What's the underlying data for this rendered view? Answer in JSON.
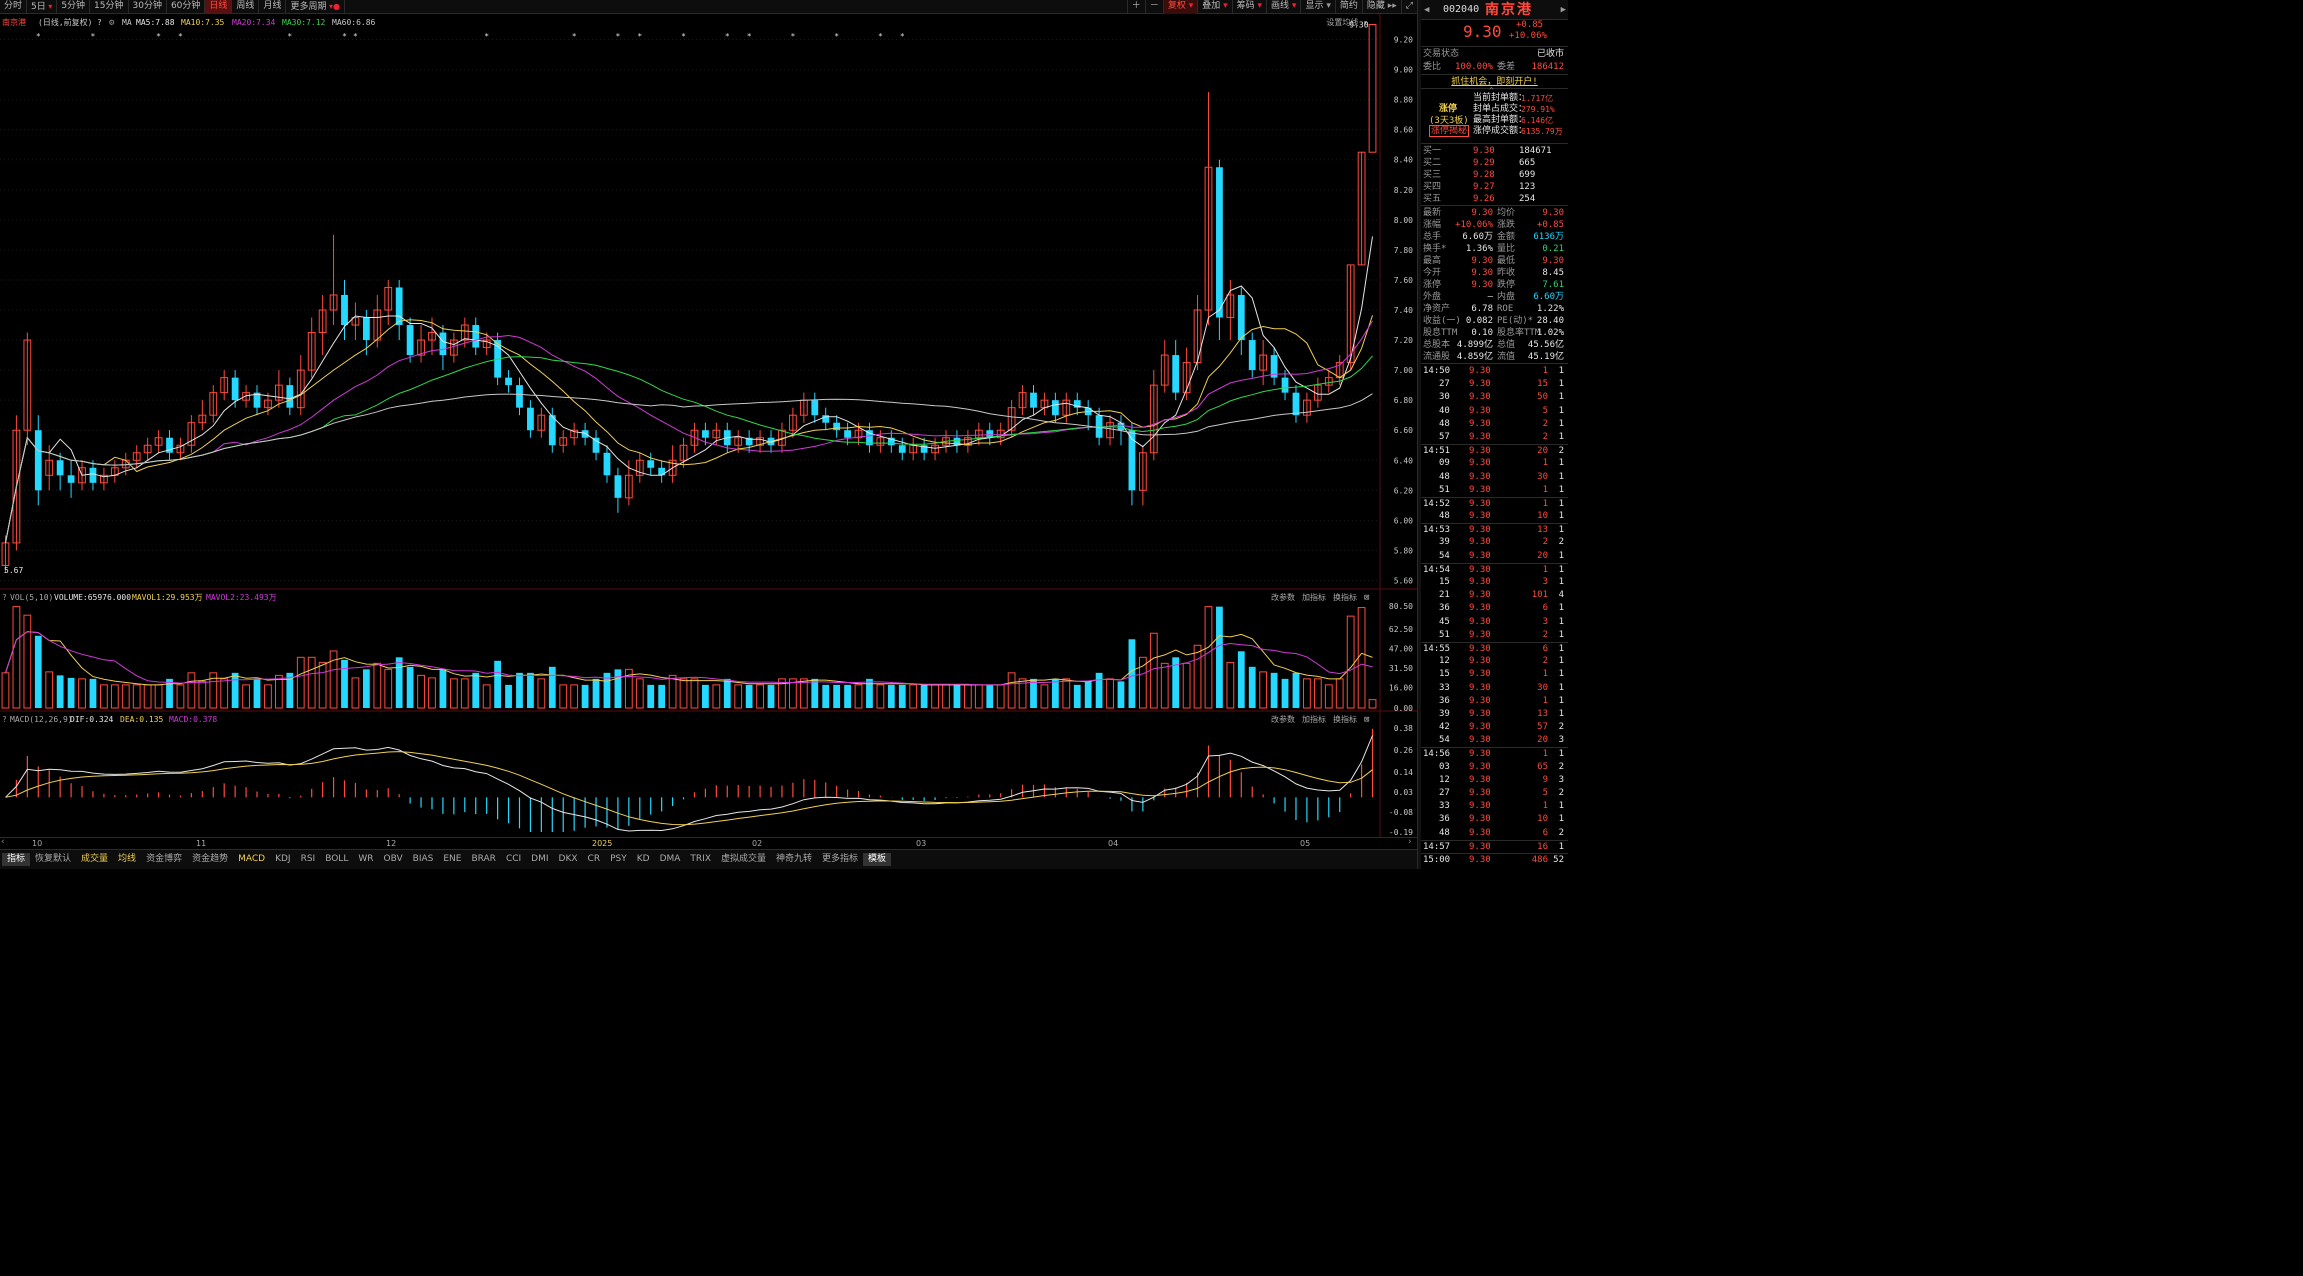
{
  "topbar": {
    "period_tabs": [
      "分时",
      "5日",
      "5分钟",
      "15分钟",
      "30分钟",
      "60分钟",
      "日线",
      "周线",
      "月线",
      "更多周期"
    ],
    "active_period": "日线",
    "tools": [
      "复权",
      "叠加",
      "筹码",
      "画线",
      "显示",
      "简约",
      "隐藏"
    ]
  },
  "main_legend": {
    "name": "南京港",
    "mode": "(日线,前复权)",
    "q": "?",
    "ma_label": "MA",
    "ma5": "MA5:7.88",
    "ma10": "MA10:7.35",
    "ma20": "MA20:7.34",
    "ma30": "MA30:7.12",
    "ma60": "MA60:6.86",
    "settings": "设置均线"
  },
  "main_axis": [
    "9.20",
    "9.00",
    "8.80",
    "8.60",
    "8.40",
    "8.20",
    "8.00",
    "7.80",
    "7.60",
    "7.40",
    "7.20",
    "7.00",
    "6.80",
    "6.60",
    "6.40",
    "6.20",
    "6.00",
    "5.80",
    "5.60"
  ],
  "main_labels": {
    "last_price": "9.30",
    "low_price": "5.67"
  },
  "vol_legend": {
    "params": "VOL(5,10)",
    "volume": "VOLUME:65976.000",
    "mavol1": "MAVOL1:29.953万",
    "mavol2": "MAVOL2:23.493万",
    "actions": [
      "改参数",
      "加指标",
      "换指标"
    ]
  },
  "vol_axis": [
    "80.50",
    "62.50",
    "47.00",
    "31.50",
    "16.00",
    "0.00"
  ],
  "macd_legend": {
    "params": "MACD(12,26,9)",
    "dif": "DIF:0.324",
    "dea": "DEA:0.135",
    "macd": "MACD:0.378",
    "actions": [
      "改参数",
      "加指标",
      "换指标"
    ]
  },
  "macd_axis": [
    "0.38",
    "0.26",
    "0.14",
    "0.03",
    "-0.08",
    "-0.19"
  ],
  "xaxis": [
    "10",
    "11",
    "12",
    "2025",
    "02",
    "03",
    "04",
    "05"
  ],
  "bottom_tabs": [
    "指标",
    "恢复默认",
    "成交量",
    "均线",
    "资金博弈",
    "资金趋势",
    "MACD",
    "KDJ",
    "RSI",
    "BOLL",
    "WR",
    "OBV",
    "BIAS",
    "ENE",
    "BRAR",
    "CCI",
    "DMI",
    "DKX",
    "CR",
    "PSY",
    "KD",
    "DMA",
    "TRIX",
    "虚拟成交量",
    "神奇九转",
    "更多指标",
    "模板"
  ],
  "bottom_selected": [
    "指标",
    "模板"
  ],
  "bottom_highlight": [
    "成交量",
    "均线",
    "MACD"
  ],
  "colors": {
    "up": "#ff4a3d",
    "down": "#25d8ff",
    "ma5": "#e6e6e6",
    "ma10": "#f0d050",
    "ma20": "#d03ad8",
    "ma30": "#2fd84a",
    "ma60": "#c8c8c8"
  },
  "quote": {
    "code": "002040",
    "name": "南京港",
    "price": "9.30",
    "change": "+0.85",
    "change_pct": "+10.06%",
    "status_label": "交易状态",
    "status_value": "已收市",
    "ratio_label": "委比",
    "ratio_value": "100.00%",
    "diff_label": "委差",
    "diff_value": "186412",
    "promo": "抓住机会，即刻开户!",
    "limit": {
      "tag": "涨停",
      "sub": "(3天3板)",
      "btn": "涨停揭秘",
      "rows": [
        {
          "label": "当前封单额：",
          "value": "1.717亿"
        },
        {
          "label": "封单占成交：",
          "value": "279.91%"
        },
        {
          "label": "最高封单额：",
          "value": "6.146亿"
        },
        {
          "label": "涨停成交额：",
          "value": "6135.79万"
        }
      ]
    },
    "buy": [
      {
        "label": "买一",
        "price": "9.30",
        "vol": "184671"
      },
      {
        "label": "买二",
        "price": "9.29",
        "vol": "665"
      },
      {
        "label": "买三",
        "price": "9.28",
        "vol": "699"
      },
      {
        "label": "买四",
        "price": "9.27",
        "vol": "123"
      },
      {
        "label": "买五",
        "price": "9.26",
        "vol": "254"
      }
    ],
    "stats": [
      [
        "最新",
        "9.30",
        "均价",
        "9.30"
      ],
      [
        "涨幅",
        "+10.06%",
        "涨跌",
        "+0.85"
      ],
      [
        "总手",
        "6.60万",
        "金额",
        "6136万"
      ],
      [
        "换手*",
        "1.36%",
        "量比",
        "0.21"
      ],
      [
        "最高",
        "9.30",
        "最低",
        "9.30"
      ],
      [
        "今开",
        "9.30",
        "昨收",
        "8.45"
      ],
      [
        "涨停",
        "9.30",
        "跌停",
        "7.61"
      ],
      [
        "外盘",
        "—",
        "内盘",
        "6.60万"
      ],
      [
        "净资产",
        "6.78",
        "ROE",
        "1.22%"
      ],
      [
        "收益(一)",
        "0.082",
        "PE(动)*",
        "28.40"
      ],
      [
        "股息TTM",
        "0.10",
        "股息率TTM",
        "1.02%"
      ],
      [
        "总股本",
        "4.899亿",
        "总值",
        "45.56亿"
      ],
      [
        "流通股",
        "4.859亿",
        "流值",
        "45.19亿"
      ]
    ]
  },
  "ticks": [
    {
      "time": "14:50",
      "price": "9.30",
      "vol": "1",
      "n": "1",
      "head": true
    },
    {
      "time": "27",
      "price": "9.30",
      "vol": "15",
      "n": "1"
    },
    {
      "time": "30",
      "price": "9.30",
      "vol": "50",
      "n": "1"
    },
    {
      "time": "40",
      "price": "9.30",
      "vol": "5",
      "n": "1"
    },
    {
      "time": "48",
      "price": "9.30",
      "vol": "2",
      "n": "1"
    },
    {
      "time": "57",
      "price": "9.30",
      "vol": "2",
      "n": "1"
    },
    {
      "time": "14:51",
      "price": "9.30",
      "vol": "20",
      "n": "2",
      "head": true
    },
    {
      "time": "09",
      "price": "9.30",
      "vol": "1",
      "n": "1"
    },
    {
      "time": "48",
      "price": "9.30",
      "vol": "30",
      "n": "1"
    },
    {
      "time": "51",
      "price": "9.30",
      "vol": "1",
      "n": "1"
    },
    {
      "time": "14:52",
      "price": "9.30",
      "vol": "1",
      "n": "1",
      "head": true
    },
    {
      "time": "48",
      "price": "9.30",
      "vol": "10",
      "n": "1"
    },
    {
      "time": "14:53",
      "price": "9.30",
      "vol": "13",
      "n": "1",
      "head": true
    },
    {
      "time": "39",
      "price": "9.30",
      "vol": "2",
      "n": "2"
    },
    {
      "time": "54",
      "price": "9.30",
      "vol": "20",
      "n": "1"
    },
    {
      "time": "14:54",
      "price": "9.30",
      "vol": "1",
      "n": "1",
      "head": true
    },
    {
      "time": "15",
      "price": "9.30",
      "vol": "3",
      "n": "1"
    },
    {
      "time": "21",
      "price": "9.30",
      "vol": "101",
      "n": "4"
    },
    {
      "time": "36",
      "price": "9.30",
      "vol": "6",
      "n": "1"
    },
    {
      "time": "45",
      "price": "9.30",
      "vol": "3",
      "n": "1"
    },
    {
      "time": "51",
      "price": "9.30",
      "vol": "2",
      "n": "1"
    },
    {
      "time": "14:55",
      "price": "9.30",
      "vol": "6",
      "n": "1",
      "head": true
    },
    {
      "time": "12",
      "price": "9.30",
      "vol": "2",
      "n": "1"
    },
    {
      "time": "15",
      "price": "9.30",
      "vol": "1",
      "n": "1"
    },
    {
      "time": "33",
      "price": "9.30",
      "vol": "30",
      "n": "1"
    },
    {
      "time": "36",
      "price": "9.30",
      "vol": "1",
      "n": "1"
    },
    {
      "time": "39",
      "price": "9.30",
      "vol": "13",
      "n": "1"
    },
    {
      "time": "42",
      "price": "9.30",
      "vol": "57",
      "n": "2"
    },
    {
      "time": "54",
      "price": "9.30",
      "vol": "20",
      "n": "3"
    },
    {
      "time": "14:56",
      "price": "9.30",
      "vol": "1",
      "n": "1",
      "head": true
    },
    {
      "time": "03",
      "price": "9.30",
      "vol": "65",
      "n": "2"
    },
    {
      "time": "12",
      "price": "9.30",
      "vol": "9",
      "n": "3"
    },
    {
      "time": "27",
      "price": "9.30",
      "vol": "5",
      "n": "2"
    },
    {
      "time": "33",
      "price": "9.30",
      "vol": "1",
      "n": "1"
    },
    {
      "time": "36",
      "price": "9.30",
      "vol": "10",
      "n": "1"
    },
    {
      "time": "48",
      "price": "9.30",
      "vol": "6",
      "n": "2"
    },
    {
      "time": "14:57",
      "price": "9.30",
      "vol": "16",
      "n": "1",
      "head": true
    },
    {
      "time": "15:00",
      "price": "9.30",
      "vol": "486",
      "n": "52",
      "head": true
    }
  ],
  "chart_data": {
    "type": "candlestick",
    "price_range": [
      5.55,
      9.25
    ],
    "candles": [
      [
        5.7,
        5.85,
        5.65,
        5.9
      ],
      [
        5.85,
        6.6,
        5.8,
        6.7
      ],
      [
        6.6,
        7.2,
        6.5,
        7.25
      ],
      [
        6.6,
        6.2,
        6.1,
        6.7
      ],
      [
        6.3,
        6.4,
        6.2,
        6.5
      ],
      [
        6.4,
        6.3,
        6.2,
        6.45
      ],
      [
        6.3,
        6.25,
        6.15,
        6.4
      ],
      [
        6.25,
        6.35,
        6.2,
        6.4
      ],
      [
        6.35,
        6.25,
        6.2,
        6.4
      ],
      [
        6.25,
        6.3,
        6.2,
        6.35
      ],
      [
        6.3,
        6.35,
        6.25,
        6.4
      ],
      [
        6.35,
        6.4,
        6.3,
        6.45
      ],
      [
        6.4,
        6.45,
        6.35,
        6.5
      ],
      [
        6.45,
        6.5,
        6.4,
        6.55
      ],
      [
        6.5,
        6.55,
        6.45,
        6.6
      ],
      [
        6.55,
        6.45,
        6.4,
        6.6
      ],
      [
        6.45,
        6.5,
        6.4,
        6.55
      ],
      [
        6.5,
        6.65,
        6.45,
        6.7
      ],
      [
        6.65,
        6.7,
        6.6,
        6.8
      ],
      [
        6.7,
        6.85,
        6.65,
        6.9
      ],
      [
        6.85,
        6.95,
        6.8,
        7.0
      ],
      [
        6.95,
        6.8,
        6.75,
        7.0
      ],
      [
        6.8,
        6.85,
        6.75,
        6.9
      ],
      [
        6.85,
        6.75,
        6.7,
        6.9
      ],
      [
        6.75,
        6.8,
        6.7,
        6.85
      ],
      [
        6.8,
        6.9,
        6.75,
        7.0
      ],
      [
        6.9,
        6.75,
        6.7,
        6.95
      ],
      [
        6.75,
        7.0,
        6.7,
        7.1
      ],
      [
        7.0,
        7.25,
        6.95,
        7.35
      ],
      [
        7.25,
        7.4,
        7.1,
        7.5
      ],
      [
        7.4,
        7.5,
        7.3,
        7.9
      ],
      [
        7.5,
        7.3,
        7.2,
        7.6
      ],
      [
        7.3,
        7.35,
        7.2,
        7.45
      ],
      [
        7.35,
        7.2,
        7.1,
        7.4
      ],
      [
        7.2,
        7.4,
        7.15,
        7.5
      ],
      [
        7.4,
        7.55,
        7.3,
        7.6
      ],
      [
        7.55,
        7.3,
        7.2,
        7.6
      ],
      [
        7.3,
        7.1,
        7.05,
        7.35
      ],
      [
        7.1,
        7.2,
        7.05,
        7.3
      ],
      [
        7.2,
        7.25,
        7.1,
        7.35
      ],
      [
        7.25,
        7.1,
        7.0,
        7.3
      ],
      [
        7.1,
        7.2,
        7.05,
        7.25
      ],
      [
        7.2,
        7.3,
        7.15,
        7.35
      ],
      [
        7.3,
        7.15,
        7.1,
        7.35
      ],
      [
        7.15,
        7.2,
        7.1,
        7.25
      ],
      [
        7.2,
        6.95,
        6.9,
        7.25
      ],
      [
        6.95,
        6.9,
        6.85,
        7.0
      ],
      [
        6.9,
        6.75,
        6.7,
        6.95
      ],
      [
        6.75,
        6.6,
        6.55,
        6.8
      ],
      [
        6.6,
        6.7,
        6.55,
        6.75
      ],
      [
        6.7,
        6.5,
        6.45,
        6.75
      ],
      [
        6.5,
        6.55,
        6.45,
        6.6
      ],
      [
        6.55,
        6.6,
        6.5,
        6.65
      ],
      [
        6.6,
        6.55,
        6.5,
        6.65
      ],
      [
        6.55,
        6.45,
        6.4,
        6.6
      ],
      [
        6.45,
        6.3,
        6.25,
        6.5
      ],
      [
        6.3,
        6.15,
        6.05,
        6.35
      ],
      [
        6.15,
        6.3,
        6.1,
        6.4
      ],
      [
        6.3,
        6.4,
        6.25,
        6.45
      ],
      [
        6.4,
        6.35,
        6.3,
        6.45
      ],
      [
        6.35,
        6.3,
        6.25,
        6.4
      ],
      [
        6.3,
        6.4,
        6.25,
        6.5
      ],
      [
        6.4,
        6.5,
        6.35,
        6.55
      ],
      [
        6.5,
        6.6,
        6.45,
        6.65
      ],
      [
        6.6,
        6.55,
        6.5,
        6.65
      ],
      [
        6.55,
        6.6,
        6.5,
        6.65
      ],
      [
        6.6,
        6.5,
        6.45,
        6.65
      ],
      [
        6.5,
        6.55,
        6.45,
        6.6
      ],
      [
        6.55,
        6.5,
        6.45,
        6.6
      ],
      [
        6.5,
        6.55,
        6.45,
        6.6
      ],
      [
        6.55,
        6.5,
        6.45,
        6.6
      ],
      [
        6.5,
        6.6,
        6.45,
        6.65
      ],
      [
        6.6,
        6.7,
        6.55,
        6.75
      ],
      [
        6.7,
        6.8,
        6.65,
        6.85
      ],
      [
        6.8,
        6.7,
        6.65,
        6.85
      ],
      [
        6.7,
        6.65,
        6.6,
        6.75
      ],
      [
        6.65,
        6.6,
        6.55,
        6.7
      ],
      [
        6.6,
        6.55,
        6.5,
        6.65
      ],
      [
        6.55,
        6.6,
        6.5,
        6.65
      ],
      [
        6.6,
        6.5,
        6.45,
        6.65
      ],
      [
        6.5,
        6.55,
        6.45,
        6.6
      ],
      [
        6.55,
        6.5,
        6.45,
        6.6
      ],
      [
        6.5,
        6.45,
        6.4,
        6.55
      ],
      [
        6.45,
        6.5,
        6.4,
        6.55
      ],
      [
        6.5,
        6.45,
        6.4,
        6.55
      ],
      [
        6.45,
        6.5,
        6.4,
        6.55
      ],
      [
        6.5,
        6.55,
        6.45,
        6.6
      ],
      [
        6.55,
        6.5,
        6.45,
        6.6
      ],
      [
        6.5,
        6.55,
        6.45,
        6.6
      ],
      [
        6.55,
        6.6,
        6.5,
        6.65
      ],
      [
        6.6,
        6.55,
        6.5,
        6.65
      ],
      [
        6.55,
        6.6,
        6.5,
        6.65
      ],
      [
        6.6,
        6.75,
        6.55,
        6.8
      ],
      [
        6.75,
        6.85,
        6.7,
        6.9
      ],
      [
        6.85,
        6.75,
        6.7,
        6.9
      ],
      [
        6.75,
        6.8,
        6.7,
        6.85
      ],
      [
        6.8,
        6.7,
        6.65,
        6.85
      ],
      [
        6.7,
        6.8,
        6.65,
        6.85
      ],
      [
        6.8,
        6.75,
        6.7,
        6.85
      ],
      [
        6.75,
        6.7,
        6.6,
        6.8
      ],
      [
        6.7,
        6.55,
        6.5,
        6.75
      ],
      [
        6.55,
        6.65,
        6.5,
        6.7
      ],
      [
        6.65,
        6.6,
        6.5,
        6.7
      ],
      [
        6.6,
        6.2,
        6.1,
        6.65
      ],
      [
        6.2,
        6.45,
        6.1,
        6.5
      ],
      [
        6.45,
        6.9,
        6.4,
        7.0
      ],
      [
        6.9,
        7.1,
        6.85,
        7.2
      ],
      [
        7.1,
        6.85,
        6.8,
        7.2
      ],
      [
        6.85,
        7.05,
        6.8,
        7.15
      ],
      [
        7.05,
        7.4,
        7.0,
        7.5
      ],
      [
        7.4,
        8.35,
        7.3,
        8.85
      ],
      [
        8.35,
        7.35,
        7.2,
        8.4
      ],
      [
        7.35,
        7.5,
        7.2,
        7.6
      ],
      [
        7.5,
        7.2,
        7.1,
        7.55
      ],
      [
        7.2,
        7.0,
        6.95,
        7.25
      ],
      [
        7.0,
        7.1,
        6.9,
        7.2
      ],
      [
        7.1,
        6.95,
        6.9,
        7.15
      ],
      [
        6.95,
        6.85,
        6.8,
        7.0
      ],
      [
        6.85,
        6.7,
        6.65,
        6.9
      ],
      [
        6.7,
        6.8,
        6.65,
        6.85
      ],
      [
        6.8,
        6.9,
        6.75,
        6.95
      ],
      [
        6.9,
        6.95,
        6.85,
        7.0
      ],
      [
        6.95,
        7.05,
        6.9,
        7.1
      ],
      [
        7.05,
        7.7,
        7.0,
        7.7
      ],
      [
        7.7,
        8.45,
        7.7,
        8.45
      ],
      [
        8.45,
        9.3,
        9.3,
        9.3
      ]
    ]
  }
}
